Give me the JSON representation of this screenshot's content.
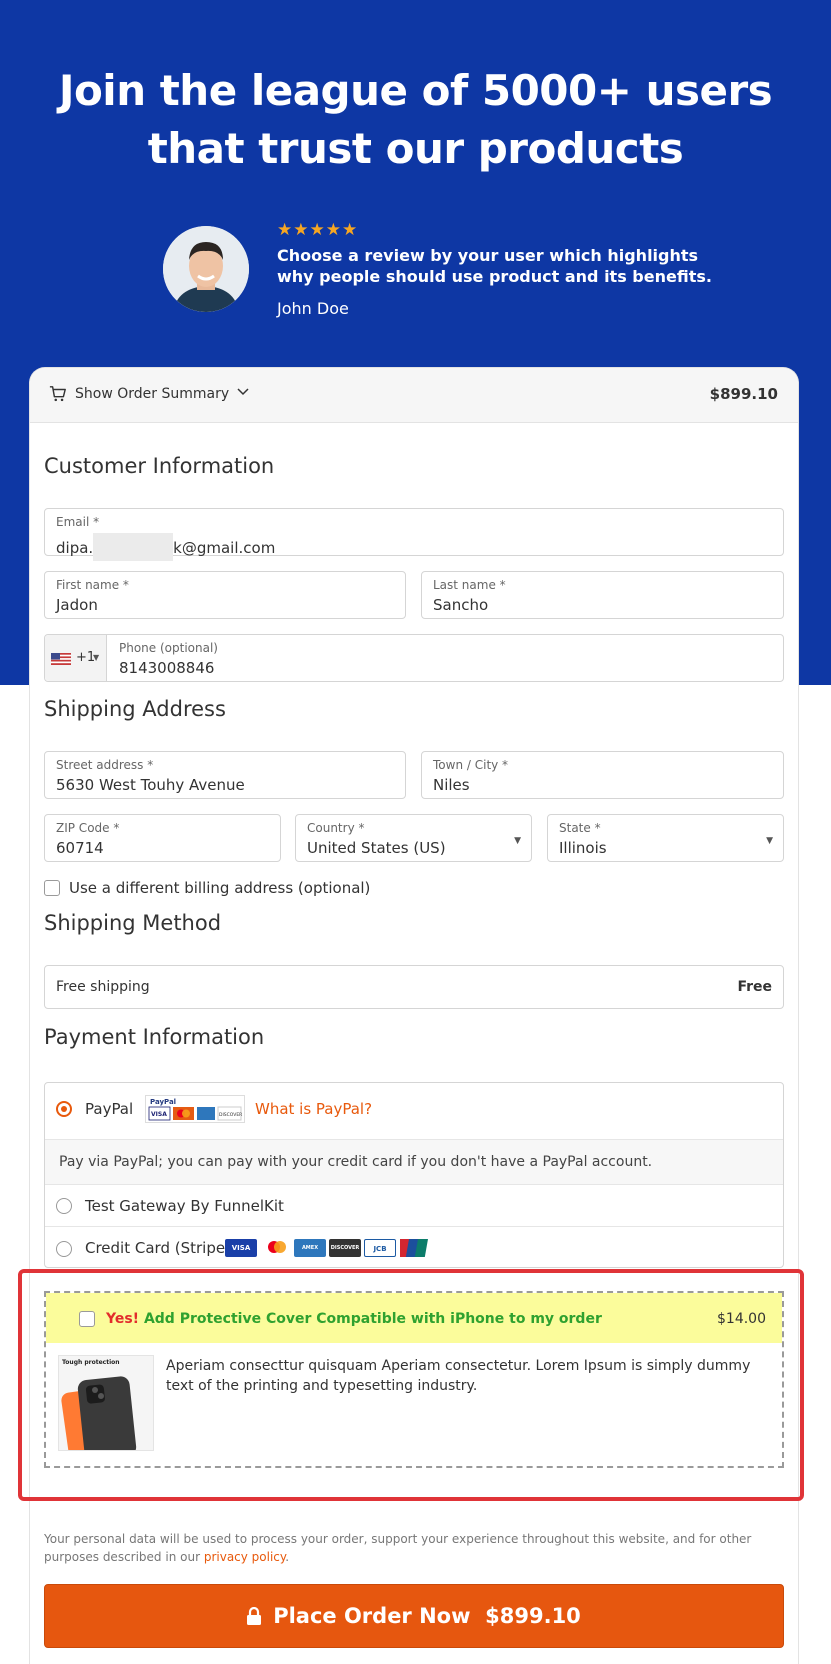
{
  "hero": {
    "title_line1": "Join the league of 5000+ users",
    "title_line2": "that trust our products",
    "stars": "★★★★★",
    "review_line1": "Choose a review by your user which highlights",
    "review_line2": "why people should use product and its benefits.",
    "reviewer": "John Doe"
  },
  "summary": {
    "label": "Show Order Summary",
    "total": "$899.10"
  },
  "customer": {
    "title": "Customer Information",
    "email_label": "Email *",
    "email_prefix": "dipa.",
    "email_suffix": "k@gmail.com",
    "first_label": "First name *",
    "first_value": "Jadon",
    "last_label": "Last name *",
    "last_value": "Sancho",
    "phone_code": "+1",
    "phone_label": "Phone (optional)",
    "phone_value": "8143008846"
  },
  "shipping": {
    "title": "Shipping Address",
    "street_label": "Street address *",
    "street_value": "5630 West Touhy Avenue",
    "city_label": "Town / City *",
    "city_value": "Niles",
    "zip_label": "ZIP Code *",
    "zip_value": "60714",
    "country_label": "Country *",
    "country_value": "United States (US)",
    "state_label": "State *",
    "state_value": "Illinois",
    "billing_checkbox": "Use a different billing address (optional)"
  },
  "method": {
    "title": "Shipping Method",
    "name": "Free shipping",
    "price": "Free"
  },
  "payment": {
    "title": "Payment Information",
    "paypal": "PayPal",
    "paypal_link": "What is PayPal?",
    "paypal_desc": "Pay via PayPal; you can pay with your credit card if you don't have a PayPal account.",
    "test_gateway": "Test Gateway By FunnelKit",
    "stripe": "Credit Card (Stripe)",
    "selected": "PayPal"
  },
  "bump": {
    "yes": "Yes!",
    "offer": "Add Protective Cover Compatible with iPhone to my order",
    "price": "$14.00",
    "image_caption": "Tough protection",
    "desc": "Aperiam consecttur quisquam Aperiam consectetur. Lorem Ipsum is simply dummy text of the printing and typesetting industry."
  },
  "footer": {
    "privacy_text": "Your personal data will be used to process your order, support your experience throughout this website, and for other purposes described in our ",
    "privacy_link": "privacy policy",
    "privacy_end": ".",
    "cta_label": "Place Order Now",
    "cta_price": "$899.10"
  },
  "colors": {
    "hero_bg": "#0e37a4",
    "accent": "#e6570f",
    "bump_bg": "#fbfc9b",
    "bump_text": "#2fa12f",
    "highlight_border": "#e03438"
  }
}
